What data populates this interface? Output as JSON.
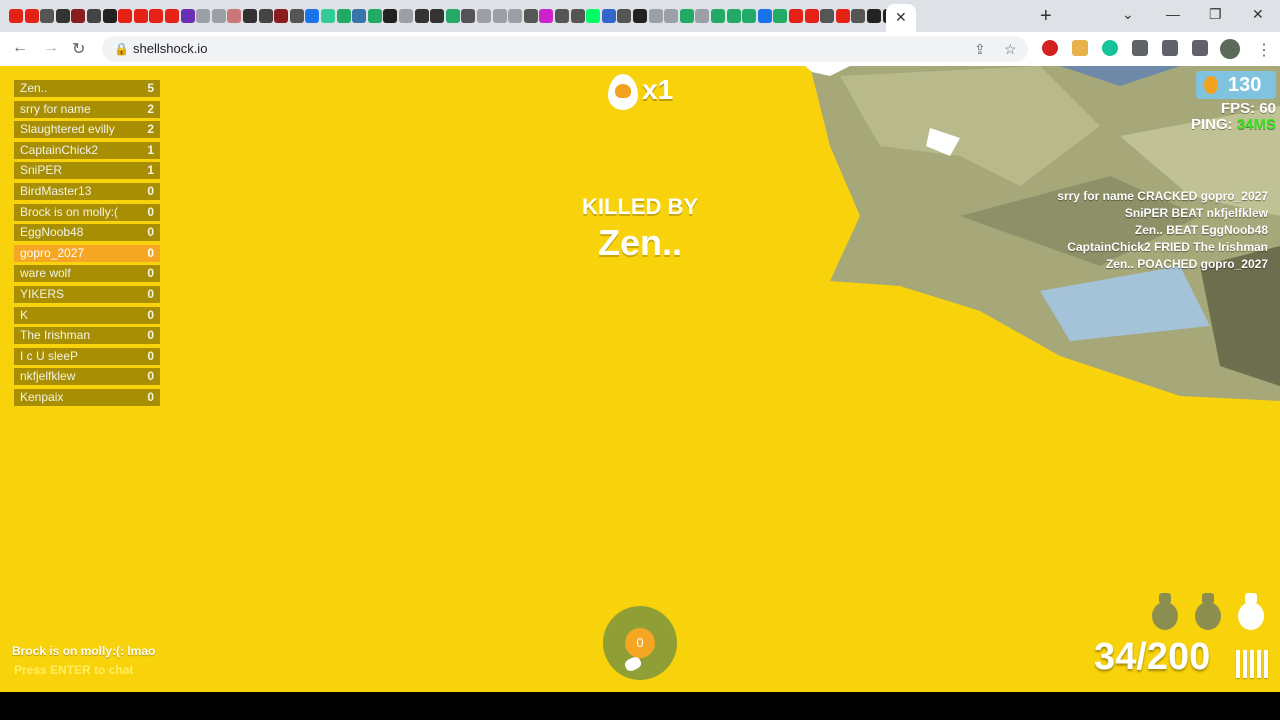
{
  "browser": {
    "url": "shellshock.io",
    "tab_close_glyph": "✕",
    "new_tab_glyph": "+",
    "window_controls": [
      "⌄",
      "—",
      "❐",
      "✕"
    ],
    "colors": {
      "tabstrip": "#dee1e6",
      "toolbar": "#ffffff",
      "omnibox": "#f1f3f4"
    }
  },
  "game": {
    "scoreboard": [
      {
        "name": "Zen..",
        "score": "5"
      },
      {
        "name": "srry for name",
        "score": "2"
      },
      {
        "name": "Slaughtered evilly",
        "score": "2"
      },
      {
        "name": "CaptainChick2",
        "score": "1"
      },
      {
        "name": "SniPER",
        "score": "1"
      },
      {
        "name": "BirdMaster13",
        "score": "0"
      },
      {
        "name": "Brock is on molly:(",
        "score": "0"
      },
      {
        "name": "EggNoob48",
        "score": "0"
      },
      {
        "name": "gopro_2027",
        "score": "0",
        "me": true
      },
      {
        "name": "ware wolf",
        "score": "0"
      },
      {
        "name": "YIKERS",
        "score": "0"
      },
      {
        "name": "K",
        "score": "0"
      },
      {
        "name": "The Irishman",
        "score": "0"
      },
      {
        "name": "I c U sleeP",
        "score": "0"
      },
      {
        "name": "nkfjelfklew",
        "score": "0"
      },
      {
        "name": "Kenpaix",
        "score": "0"
      }
    ],
    "kill_multiplier": "x1",
    "killed_by_label": "KILLED BY",
    "killer_name": "Zen..",
    "eggs": "130",
    "fps_label": "FPS: 60",
    "ping_label": "PING:",
    "ping_value": "34MS",
    "kill_feed": [
      "srry for name CRACKED gopro_2027",
      "SniPER BEAT nkfjelfklew",
      "Zen.. BEAT EggNoob48",
      "CaptainChick2 FRIED The Irishman",
      "Zen.. POACHED gopro_2027"
    ],
    "grenade_count": "0",
    "ammo": "34/200",
    "chat_message": "Brock is on molly:(: lmao",
    "chat_hint": "Press ENTER to chat",
    "colors": {
      "paint": "#f8d20a",
      "highlight": "#f5a623",
      "ping_good": "#39e51f",
      "hud_text": "#ffffff"
    }
  }
}
